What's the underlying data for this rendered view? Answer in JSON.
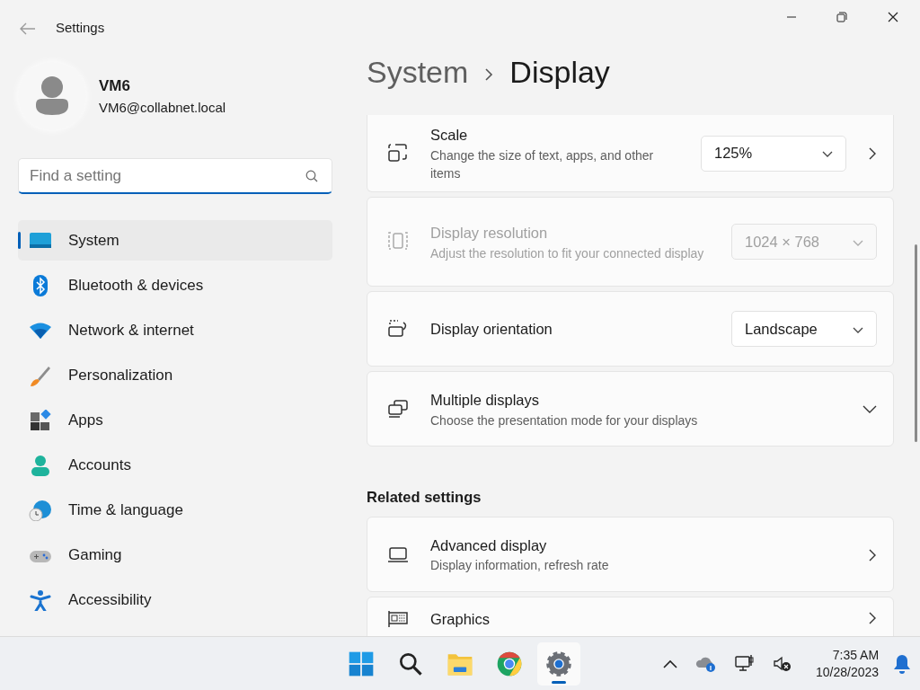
{
  "window": {
    "title": "Settings"
  },
  "user": {
    "name": "VM6",
    "email": "VM6@collabnet.local"
  },
  "search": {
    "placeholder": "Find a setting"
  },
  "nav": [
    {
      "label": "System",
      "selected": true
    },
    {
      "label": "Bluetooth & devices",
      "selected": false
    },
    {
      "label": "Network & internet",
      "selected": false
    },
    {
      "label": "Personalization",
      "selected": false
    },
    {
      "label": "Apps",
      "selected": false
    },
    {
      "label": "Accounts",
      "selected": false
    },
    {
      "label": "Time & language",
      "selected": false
    },
    {
      "label": "Gaming",
      "selected": false
    },
    {
      "label": "Accessibility",
      "selected": false
    }
  ],
  "breadcrumb": [
    "System",
    "Display"
  ],
  "settings": [
    {
      "title": "Scale",
      "description": "Change the size of text, apps, and other items",
      "dropdown": "125%",
      "kind": "link",
      "disabled": false
    },
    {
      "title": "Display resolution",
      "description": "Adjust the resolution to fit your connected display",
      "dropdown": "1024 × 768",
      "kind": "plain",
      "disabled": true
    },
    {
      "title": "Display orientation",
      "dropdown": "Landscape",
      "kind": "plain",
      "disabled": false
    },
    {
      "title": "Multiple displays",
      "description": "Choose the presentation mode for your displays",
      "kind": "expander",
      "expanded": false,
      "disabled": false
    }
  ],
  "related": {
    "heading": "Related settings",
    "items": [
      {
        "title": "Advanced display",
        "description": "Display information, refresh rate",
        "kind": "link",
        "disabled": false
      },
      {
        "title": "Graphics",
        "kind": "link",
        "disabled": false
      }
    ]
  },
  "taskbar": {
    "apps": [
      {
        "selected": false
      },
      {
        "selected": false
      },
      {
        "selected": false
      },
      {
        "selected": false
      },
      {
        "selected": true
      }
    ],
    "time": "7:35 AM",
    "date": "10/28/2023"
  }
}
